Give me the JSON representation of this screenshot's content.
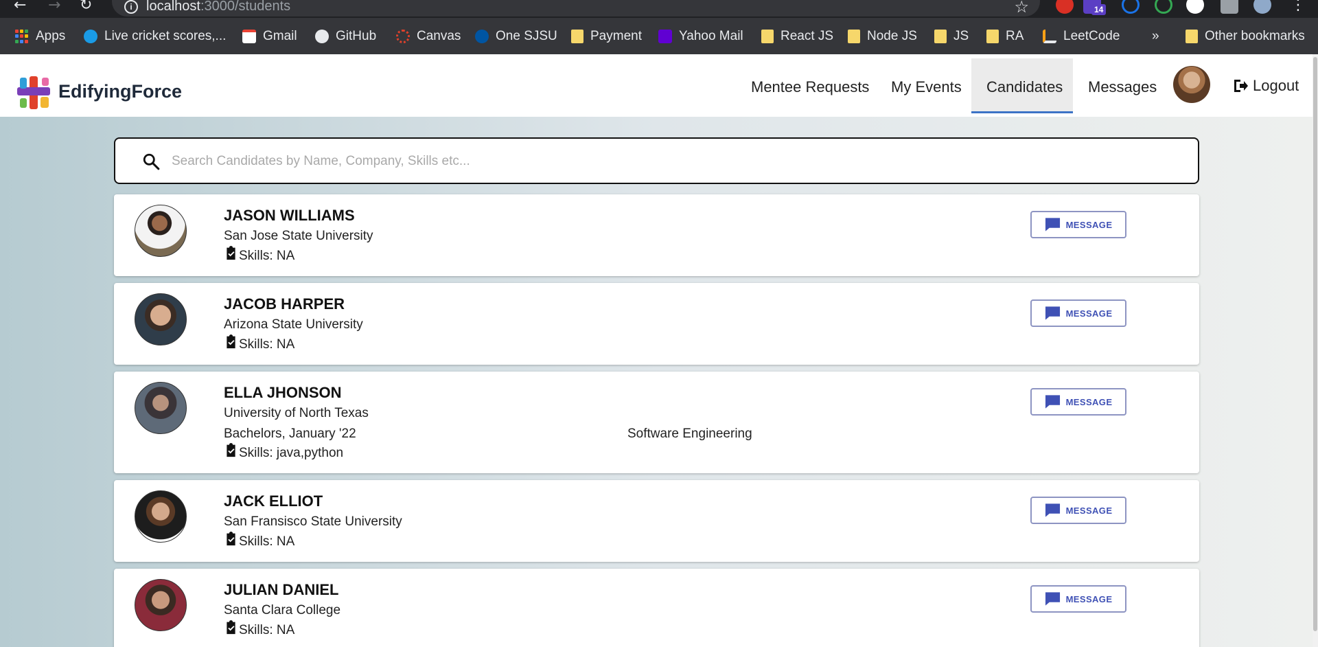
{
  "browser": {
    "url_host": "localhost",
    "url_path": ":3000/students",
    "extension_badge": "14",
    "bookmarks": [
      {
        "label": "Apps",
        "icon": "apps-grid-icon"
      },
      {
        "label": "Live cricket scores,...",
        "icon": "globe-icon"
      },
      {
        "label": "Gmail",
        "icon": "gmail-icon"
      },
      {
        "label": "GitHub",
        "icon": "github-icon"
      },
      {
        "label": "Canvas",
        "icon": "canvas-icon"
      },
      {
        "label": "One SJSU",
        "icon": "sjsu-icon"
      },
      {
        "label": "Payment",
        "icon": "folder-icon"
      },
      {
        "label": "Yahoo Mail",
        "icon": "yahoo-mail-icon"
      },
      {
        "label": "React JS",
        "icon": "folder-icon"
      },
      {
        "label": "Node JS",
        "icon": "folder-icon"
      },
      {
        "label": "JS",
        "icon": "folder-icon"
      },
      {
        "label": "RA",
        "icon": "folder-icon"
      },
      {
        "label": "LeetCode",
        "icon": "leetcode-icon"
      }
    ],
    "overflow_label": "»",
    "other_bookmarks": "Other bookmarks"
  },
  "header": {
    "brand": "EdifyingForce",
    "nav": [
      {
        "label": "Mentee Requests",
        "active": false
      },
      {
        "label": "My Events",
        "active": false
      },
      {
        "label": "Candidates",
        "active": true
      },
      {
        "label": "Messages",
        "active": false
      }
    ],
    "logout_label": "Logout",
    "accent_color": "#3c73c6"
  },
  "search": {
    "placeholder": "Search Candidates by Name, Company, Skills etc...",
    "value": ""
  },
  "message_button_label": "MESSAGE",
  "button_color": "#3f51b5",
  "candidates": [
    {
      "name": "JASON WILLIAMS",
      "school": "San Jose State University",
      "degree": "",
      "major": "",
      "skills": "Skills: NA"
    },
    {
      "name": "JACOB HARPER",
      "school": "Arizona State University",
      "degree": "",
      "major": "",
      "skills": "Skills: NA"
    },
    {
      "name": "ELLA JHONSON",
      "school": "University of North Texas",
      "degree": "Bachelors, January '22",
      "major": "Software Engineering",
      "skills": "Skills: java,python"
    },
    {
      "name": "JACK ELLIOT",
      "school": "San Fransisco State University",
      "degree": "",
      "major": "",
      "skills": "Skills: NA"
    },
    {
      "name": "JULIAN DANIEL",
      "school": "Santa Clara College",
      "degree": "",
      "major": "",
      "skills": "Skills: NA"
    }
  ]
}
